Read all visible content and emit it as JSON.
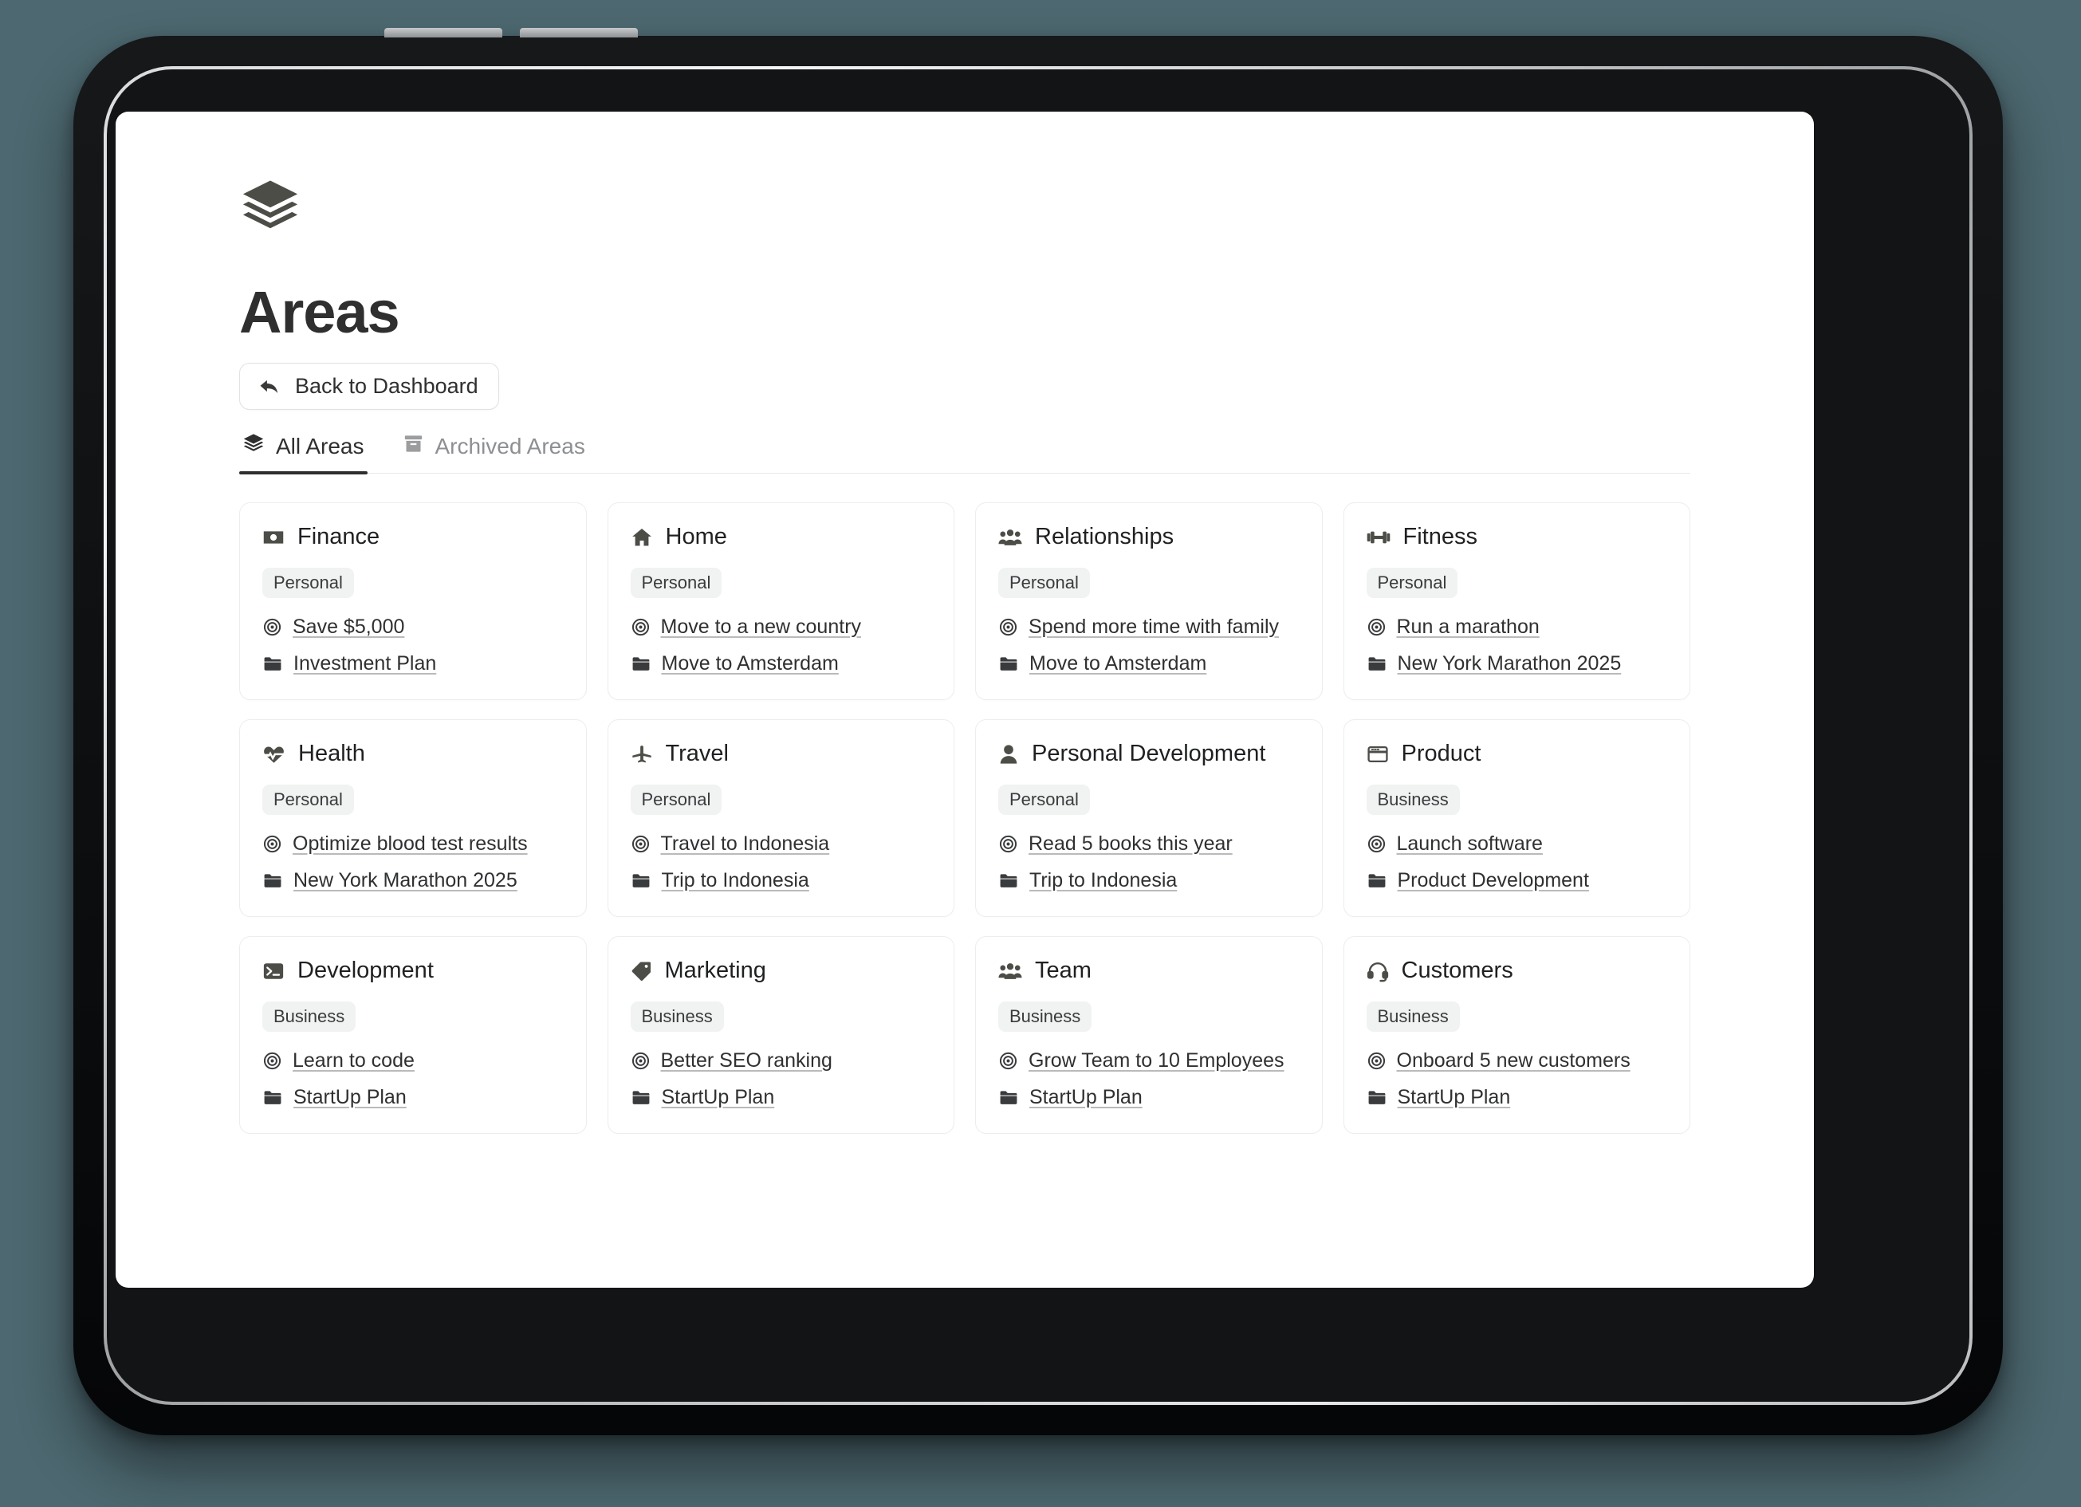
{
  "header": {
    "logo_icon": "layers-stack-icon",
    "title": "Areas",
    "back_button": {
      "label": "Back to Dashboard",
      "icon": "reply-arrow-icon"
    }
  },
  "tabs": [
    {
      "label": "All Areas",
      "icon": "layers-stack-icon",
      "active": true
    },
    {
      "label": "Archived Areas",
      "icon": "archive-box-icon",
      "active": false
    }
  ],
  "areas": [
    {
      "name": "Finance",
      "icon": "money-bill-icon",
      "tag": "Personal",
      "goal": "Save $5,000",
      "goal_icon": "target-icon",
      "project": "Investment Plan",
      "project_icon": "folder-icon"
    },
    {
      "name": "Home",
      "icon": "house-icon",
      "tag": "Personal",
      "goal": "Move to a new country",
      "goal_icon": "target-icon",
      "project": "Move to Amsterdam",
      "project_icon": "folder-icon"
    },
    {
      "name": "Relationships",
      "icon": "people-group-icon",
      "tag": "Personal",
      "goal": "Spend more time with family",
      "goal_icon": "target-icon",
      "project": "Move to Amsterdam",
      "project_icon": "folder-icon"
    },
    {
      "name": "Fitness",
      "icon": "dumbbell-icon",
      "tag": "Personal",
      "goal": "Run a marathon",
      "goal_icon": "target-icon",
      "project": "New York Marathon 2025",
      "project_icon": "folder-icon"
    },
    {
      "name": "Health",
      "icon": "heart-pulse-icon",
      "tag": "Personal",
      "goal": "Optimize blood test results",
      "goal_icon": "target-icon",
      "project": "New York Marathon 2025",
      "project_icon": "folder-icon"
    },
    {
      "name": "Travel",
      "icon": "airplane-icon",
      "tag": "Personal",
      "goal": "Travel to Indonesia",
      "goal_icon": "target-icon",
      "project": "Trip to Indonesia",
      "project_icon": "folder-icon"
    },
    {
      "name": "Personal Development",
      "icon": "person-bust-icon",
      "tag": "Personal",
      "goal": "Read 5 books this year",
      "goal_icon": "target-icon",
      "project": "Trip to Indonesia",
      "project_icon": "folder-icon"
    },
    {
      "name": "Product",
      "icon": "window-app-icon",
      "tag": "Business",
      "goal": "Launch software",
      "goal_icon": "target-icon",
      "project": "Product Development",
      "project_icon": "folder-icon"
    },
    {
      "name": "Development",
      "icon": "terminal-icon",
      "tag": "Business",
      "goal": "Learn to code",
      "goal_icon": "target-icon",
      "project": "StartUp Plan",
      "project_icon": "folder-icon"
    },
    {
      "name": "Marketing",
      "icon": "tag-icon",
      "tag": "Business",
      "goal": "Better SEO ranking",
      "goal_icon": "target-icon",
      "project": "StartUp Plan",
      "project_icon": "folder-icon"
    },
    {
      "name": "Team",
      "icon": "people-group-icon",
      "tag": "Business",
      "goal": "Grow Team to 10 Employees",
      "goal_icon": "target-icon",
      "project": "StartUp Plan",
      "project_icon": "folder-icon"
    },
    {
      "name": "Customers",
      "icon": "headset-icon",
      "tag": "Business",
      "goal": "Onboard 5 new customers",
      "goal_icon": "target-icon",
      "project": "StartUp Plan",
      "project_icon": "folder-icon"
    }
  ],
  "colors": {
    "page_background": "#4d6870",
    "screen_background": "#ffffff",
    "text_primary": "#2f2f2f",
    "text_muted": "#8d8f92",
    "tag_background": "#f1f2f2",
    "card_border": "#eceded",
    "icon_fill": "#4d4d48"
  }
}
